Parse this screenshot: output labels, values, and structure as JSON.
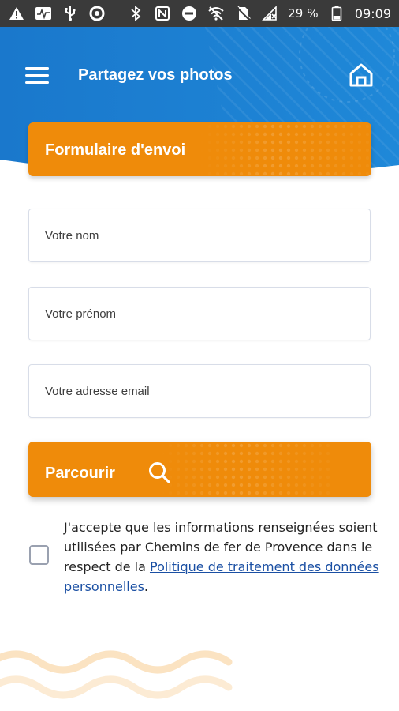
{
  "status_bar": {
    "battery": "29 %",
    "time": "09:09"
  },
  "header": {
    "title": "Partagez vos photos"
  },
  "banner": {
    "title": "Formulaire d'envoi"
  },
  "form": {
    "name_placeholder": "Votre nom",
    "firstname_placeholder": "Votre prénom",
    "email_placeholder": "Votre adresse email",
    "browse_label": "Parcourir"
  },
  "consent": {
    "text_before": "J'accepte que les informations renseignées soient utilisées par Chemins de fer de Provence dans le respect de la ",
    "link": "Politique de traitement des données personnelles",
    "text_after": ".",
    "checked": false
  },
  "colors": {
    "header_blue": "#1c7fd0",
    "accent_orange": "#ef8b0a",
    "status_bar": "#3a3a3a",
    "link": "#1a4fa3"
  }
}
